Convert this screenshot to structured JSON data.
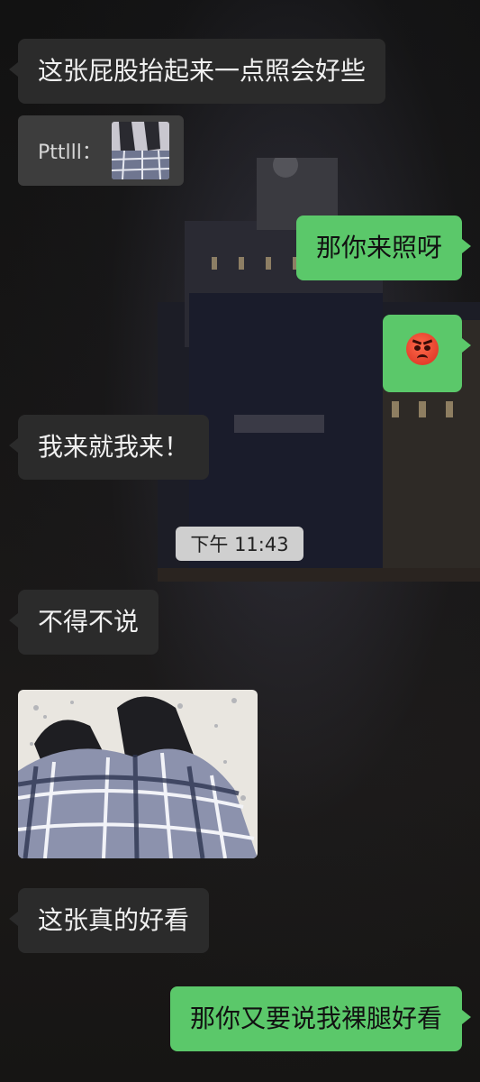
{
  "messages": [
    {
      "side": "incoming",
      "text": "这张屁股抬起来一点照会好些"
    },
    {
      "side": "quote",
      "author": "Pttlll："
    },
    {
      "side": "outgoing",
      "text": "那你来照呀"
    },
    {
      "side": "outgoing",
      "emoji": "angry-face-icon"
    },
    {
      "side": "incoming",
      "text": "我来就我来！"
    },
    {
      "side": "timestamp",
      "text": "下午 11:43"
    },
    {
      "side": "incoming",
      "text": "不得不说"
    },
    {
      "side": "incoming",
      "image": "photo-skirt"
    },
    {
      "side": "incoming",
      "text": "这张真的好看"
    },
    {
      "side": "outgoing",
      "text": "那你又要说我裸腿好看"
    }
  ],
  "colors": {
    "incoming_bubble": "#2b2b2b",
    "outgoing_bubble": "#5bc86a",
    "timestamp_bg": "#cfcfcf"
  }
}
